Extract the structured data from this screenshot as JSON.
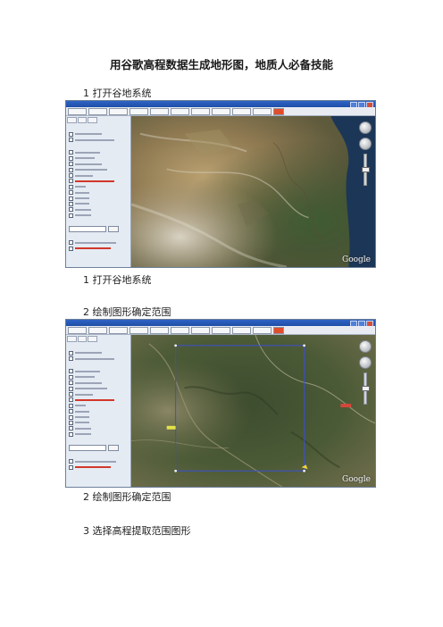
{
  "document": {
    "title": "用谷歌高程数据生成地形图，地质人必备技能"
  },
  "steps": [
    {
      "heading": "1 打开谷地系统",
      "caption": "1 打开谷地系统"
    },
    {
      "heading": "2 绘制图形确定范围",
      "caption": "2 绘制图形确定范围"
    },
    {
      "heading": "3 选择高程提取范围图形"
    }
  ],
  "screenshot": {
    "map_brand": "Google",
    "toolbar_buttons": [
      "",
      "",
      "",
      "",
      "",
      "",
      "",
      "",
      "",
      ""
    ],
    "side_tabs": [
      "",
      "",
      ""
    ],
    "colors": {
      "window_titlebar": "#1e4ea8",
      "selection_rectangle": "#3c4fd0",
      "highlight_red": "#e24d2c"
    }
  },
  "icons": {
    "navigation_compass": "compass-ring-icon",
    "zoom_slider": "zoom-slider-icon"
  }
}
